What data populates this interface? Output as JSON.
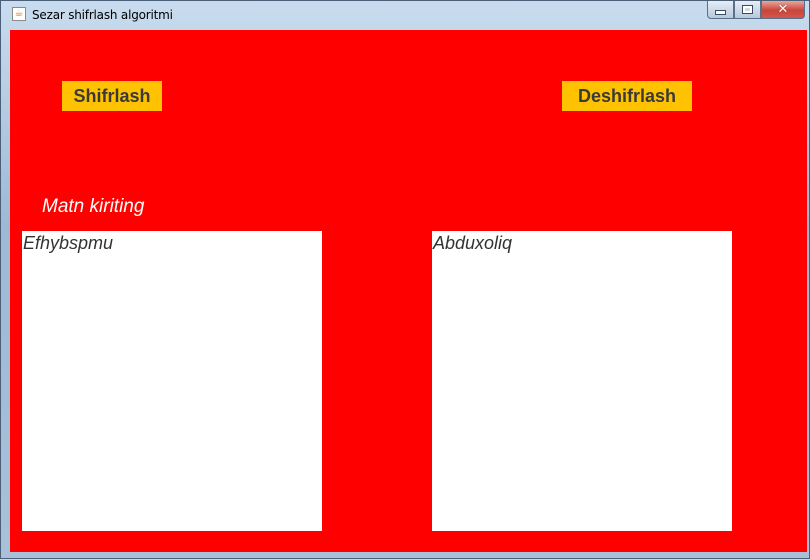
{
  "window": {
    "title": "Sezar shifrlash algoritmi",
    "icon": "java-icon"
  },
  "buttons": {
    "encrypt_label": "Shifrlash",
    "decrypt_label": "Deshifrlash"
  },
  "input_label": "Matn kiriting",
  "left_text": "Efhybspmu",
  "right_text": "Abduxoliq",
  "colors": {
    "panel_bg": "#ff0000",
    "button_bg": "#ffc200",
    "button_text": "#3a3a3a",
    "label_text": "#ffffff"
  }
}
